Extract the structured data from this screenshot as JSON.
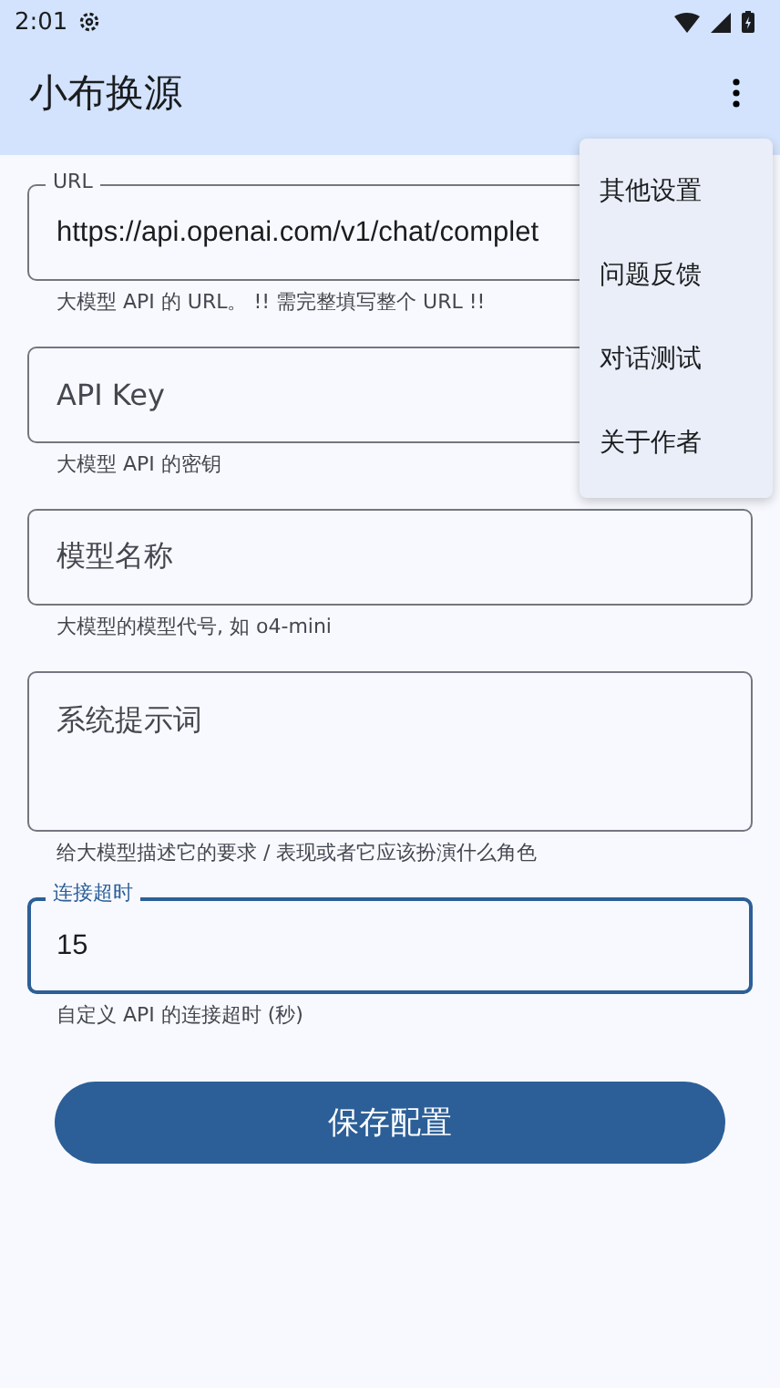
{
  "status_bar": {
    "time": "2:01"
  },
  "app_bar": {
    "title": "小布换源"
  },
  "fields": [
    {
      "kind": "single",
      "label": "URL",
      "value": "https://api.openai.com/v1/chat/complet",
      "helper": "大模型 API 的 URL。 !! 需完整填写整个 URL !!",
      "focused": false
    },
    {
      "kind": "single",
      "placeholder": "API Key",
      "helper": "大模型 API 的密钥",
      "focused": false
    },
    {
      "kind": "single",
      "placeholder": "模型名称",
      "helper": "大模型的模型代号, 如 o4-mini",
      "focused": false
    },
    {
      "kind": "multiline",
      "placeholder": "系统提示词",
      "helper": "给大模型描述它的要求 / 表现或者它应该扮演什么角色",
      "focused": false
    },
    {
      "kind": "single",
      "label": "连接超时",
      "value": "15",
      "helper": "自定义 API 的连接超时 (秒)",
      "focused": true
    }
  ],
  "save_button": "保存配置",
  "menu": [
    "其他设置",
    "问题反馈",
    "对话测试",
    "关于作者"
  ]
}
